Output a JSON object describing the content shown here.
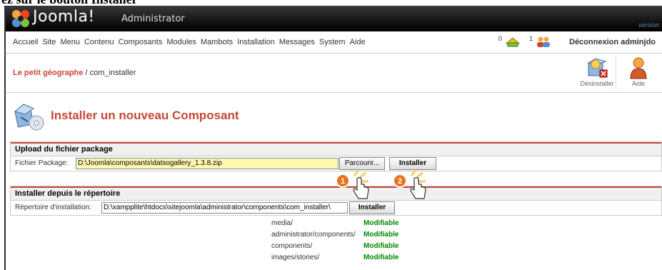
{
  "top_cut_text": "ez sur le bouton Installer",
  "header": {
    "logo_text": "Joomla!",
    "logo_sub": "Administrator",
    "version": "version"
  },
  "menu": {
    "items": [
      "Accueil",
      "Site",
      "Menu",
      "Contenu",
      "Composants",
      "Modules",
      "Mambots",
      "Installation",
      "Messages",
      "System",
      "Aide"
    ],
    "messages_count": "0",
    "users_count": "1",
    "logout": "Déconnexion adminjdo"
  },
  "pathway": {
    "site": "Le petit géographe",
    "rest": " / com_installer"
  },
  "toolbar": {
    "uninstall": "Désinstaller",
    "help": "Aide"
  },
  "page_title": "Installer un nouveau Composant",
  "upload": {
    "heading": "Upload du fichier package",
    "label": "Fichier Package:",
    "value": "D:\\Joomla\\composants\\datsogallery_1.3.8.zip",
    "browse": "Parcourir...",
    "install": "Installer"
  },
  "directory": {
    "heading": "Installer depuis le répertoire",
    "label": "Répertoire d'installation:",
    "value": "D:\\xampplite\\htdocs\\sitejoomla\\administrator\\components\\com_installer\\",
    "install": "Installer"
  },
  "permissions": [
    {
      "path": "media/",
      "status": "Modifiable"
    },
    {
      "path": "administrator/components/",
      "status": "Modifiable"
    },
    {
      "path": "components/",
      "status": "Modifiable"
    },
    {
      "path": "images/stories/",
      "status": "Modifiable"
    }
  ],
  "markers": [
    "1",
    "2"
  ],
  "colors": {
    "accent": "#c64934",
    "writable": "#008800",
    "header_bg": "#141414"
  }
}
